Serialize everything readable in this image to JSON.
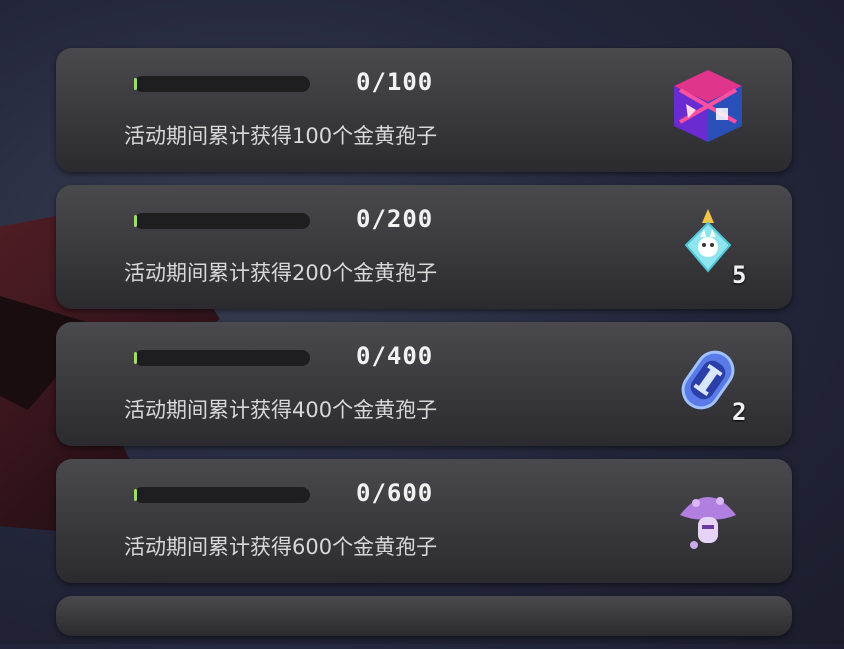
{
  "tasks": [
    {
      "progress": "0/100",
      "fill": 0,
      "desc": "活动期间累计获得100个金黄孢子",
      "reward_icon": "cube-gift-box-icon",
      "count": ""
    },
    {
      "progress": "0/200",
      "fill": 0,
      "desc": "活动期间累计获得200个金黄孢子",
      "reward_icon": "crystal-pendant-icon",
      "count": "5"
    },
    {
      "progress": "0/400",
      "fill": 0,
      "desc": "活动期间累计获得400个金黄孢子",
      "reward_icon": "energy-capsule-icon",
      "count": "2"
    },
    {
      "progress": "0/600",
      "fill": 0,
      "desc": "活动期间累计获得600个金黄孢子",
      "reward_icon": "purple-mushroom-icon",
      "count": ""
    }
  ],
  "colors": {
    "progress_accent": "#9be060",
    "card_bg": "#3a3a3e",
    "ember": "#ff6a4a"
  }
}
